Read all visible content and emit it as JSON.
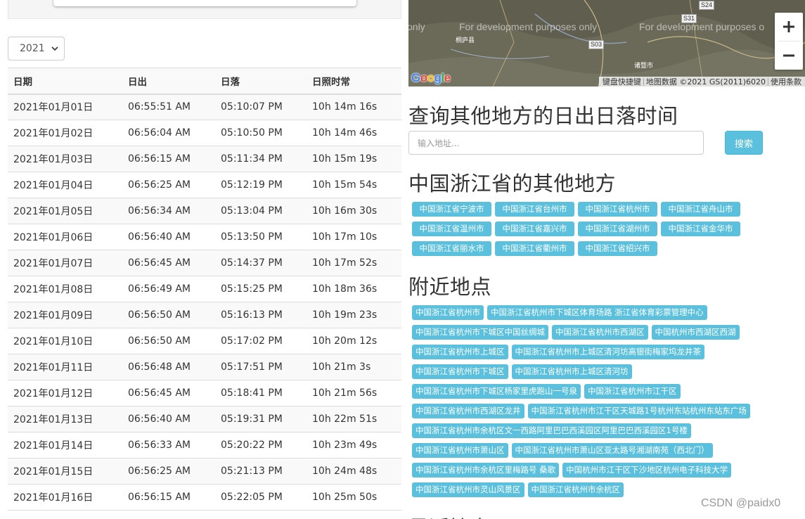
{
  "year_select": {
    "value": "2021"
  },
  "table": {
    "headers": [
      "日期",
      "日出",
      "日落",
      "日照时常"
    ],
    "rows": [
      [
        "2021年01月01日",
        "06:55:51 AM",
        "05:10:07 PM",
        "10h 14m 16s"
      ],
      [
        "2021年01月02日",
        "06:56:04 AM",
        "05:10:50 PM",
        "10h 14m 46s"
      ],
      [
        "2021年01月03日",
        "06:56:15 AM",
        "05:11:34 PM",
        "10h 15m 19s"
      ],
      [
        "2021年01月04日",
        "06:56:25 AM",
        "05:12:19 PM",
        "10h 15m 54s"
      ],
      [
        "2021年01月05日",
        "06:56:34 AM",
        "05:13:04 PM",
        "10h 16m 30s"
      ],
      [
        "2021年01月06日",
        "06:56:40 AM",
        "05:13:50 PM",
        "10h 17m 10s"
      ],
      [
        "2021年01月07日",
        "06:56:45 AM",
        "05:14:37 PM",
        "10h 17m 52s"
      ],
      [
        "2021年01月08日",
        "06:56:49 AM",
        "05:15:25 PM",
        "10h 18m 36s"
      ],
      [
        "2021年01月09日",
        "06:56:50 AM",
        "05:16:13 PM",
        "10h 19m 23s"
      ],
      [
        "2021年01月10日",
        "06:56:50 AM",
        "05:17:02 PM",
        "10h 20m 12s"
      ],
      [
        "2021年01月11日",
        "06:56:48 AM",
        "05:17:51 PM",
        "10h 21m 3s"
      ],
      [
        "2021年01月12日",
        "06:56:45 AM",
        "05:18:41 PM",
        "10h 21m 56s"
      ],
      [
        "2021年01月13日",
        "06:56:40 AM",
        "05:19:31 PM",
        "10h 22m 51s"
      ],
      [
        "2021年01月14日",
        "06:56:33 AM",
        "05:20:22 PM",
        "10h 23m 49s"
      ],
      [
        "2021年01月15日",
        "06:56:25 AM",
        "05:21:13 PM",
        "10h 24m 48s"
      ],
      [
        "2021年01月16日",
        "06:56:15 AM",
        "05:22:05 PM",
        "10h 25m 50s"
      ]
    ]
  },
  "map": {
    "watermark_text": [
      "only",
      "For development purposes only",
      "For development purposes o"
    ],
    "roads": [
      "S24",
      "S31",
      "S03"
    ],
    "towns": [
      "桐庐县",
      "诸暨市"
    ],
    "google_logo": "Google",
    "attribution": [
      "键盘快捷键",
      "地图数据 ©2021 GS(2011)6020",
      "使用条款"
    ],
    "zoom_in": "+",
    "zoom_out": "−"
  },
  "search": {
    "heading": "查询其他地方的日出日落时间",
    "placeholder": "输入地址...",
    "button": "搜索"
  },
  "other_places": {
    "heading": "中国浙江省的其他地方",
    "rows": [
      [
        "中国浙江省宁波市",
        "中国浙江省台州市",
        "中国浙江省杭州市",
        "中国浙江省舟山市"
      ],
      [
        "中国浙江省温州市",
        "中国浙江省嘉兴市",
        "中国浙江省湖州市",
        "中国浙江省金华市"
      ],
      [
        "中国浙江省丽水市",
        "中国浙江省衢州市",
        "中国浙江省绍兴市"
      ]
    ]
  },
  "nearby": {
    "heading": "附近地点",
    "rows": [
      [
        "中国浙江省杭州市",
        "中国浙江省杭州市下城区体育场路 浙江省体育彩票管理中心"
      ],
      [
        "中国浙江省杭州市下城区中国丝绸城",
        "中国浙江省杭州市西湖区",
        "中国杭州市西湖区西湖"
      ],
      [
        "中国浙江省杭州市上城区",
        "中国浙江省杭州市上城区清河坊高银街梅家坞龙井茶"
      ],
      [
        "中国浙江省杭州市下城区",
        "中国浙江省杭州市上城区清河坊"
      ],
      [
        "中国浙江省杭州市下城区杨家里虎跑山一号泉",
        "中国浙江省杭州市江干区"
      ],
      [
        "中国浙江省杭州市西湖区龙井",
        "中国浙江省杭州市江干区天城路1号杭州东站杭州东站东广场"
      ],
      [
        "中国浙江省杭州市余杭区文一西路阿里巴巴西溪园区阿里巴巴西溪园区1号楼"
      ],
      [
        "中国浙江省杭州市萧山区",
        "中国浙江省杭州市萧山区亚太路号湘湖南苑（西北门）"
      ],
      [
        "中国浙江省杭州市余杭区里梅路号 桑歌",
        "中国杭州市江干区下沙地区杭州电子科技大学"
      ],
      [
        "中国浙江省杭州市灵山风景区",
        "中国浙江省杭州市余杭区"
      ]
    ]
  },
  "cut_heading": "最近搜索",
  "csdn_watermark": "CSDN @paidx0",
  "colors": {
    "tag_bg": "#5bc0de",
    "text": "#333333",
    "stripe": "#f9f9f9"
  }
}
